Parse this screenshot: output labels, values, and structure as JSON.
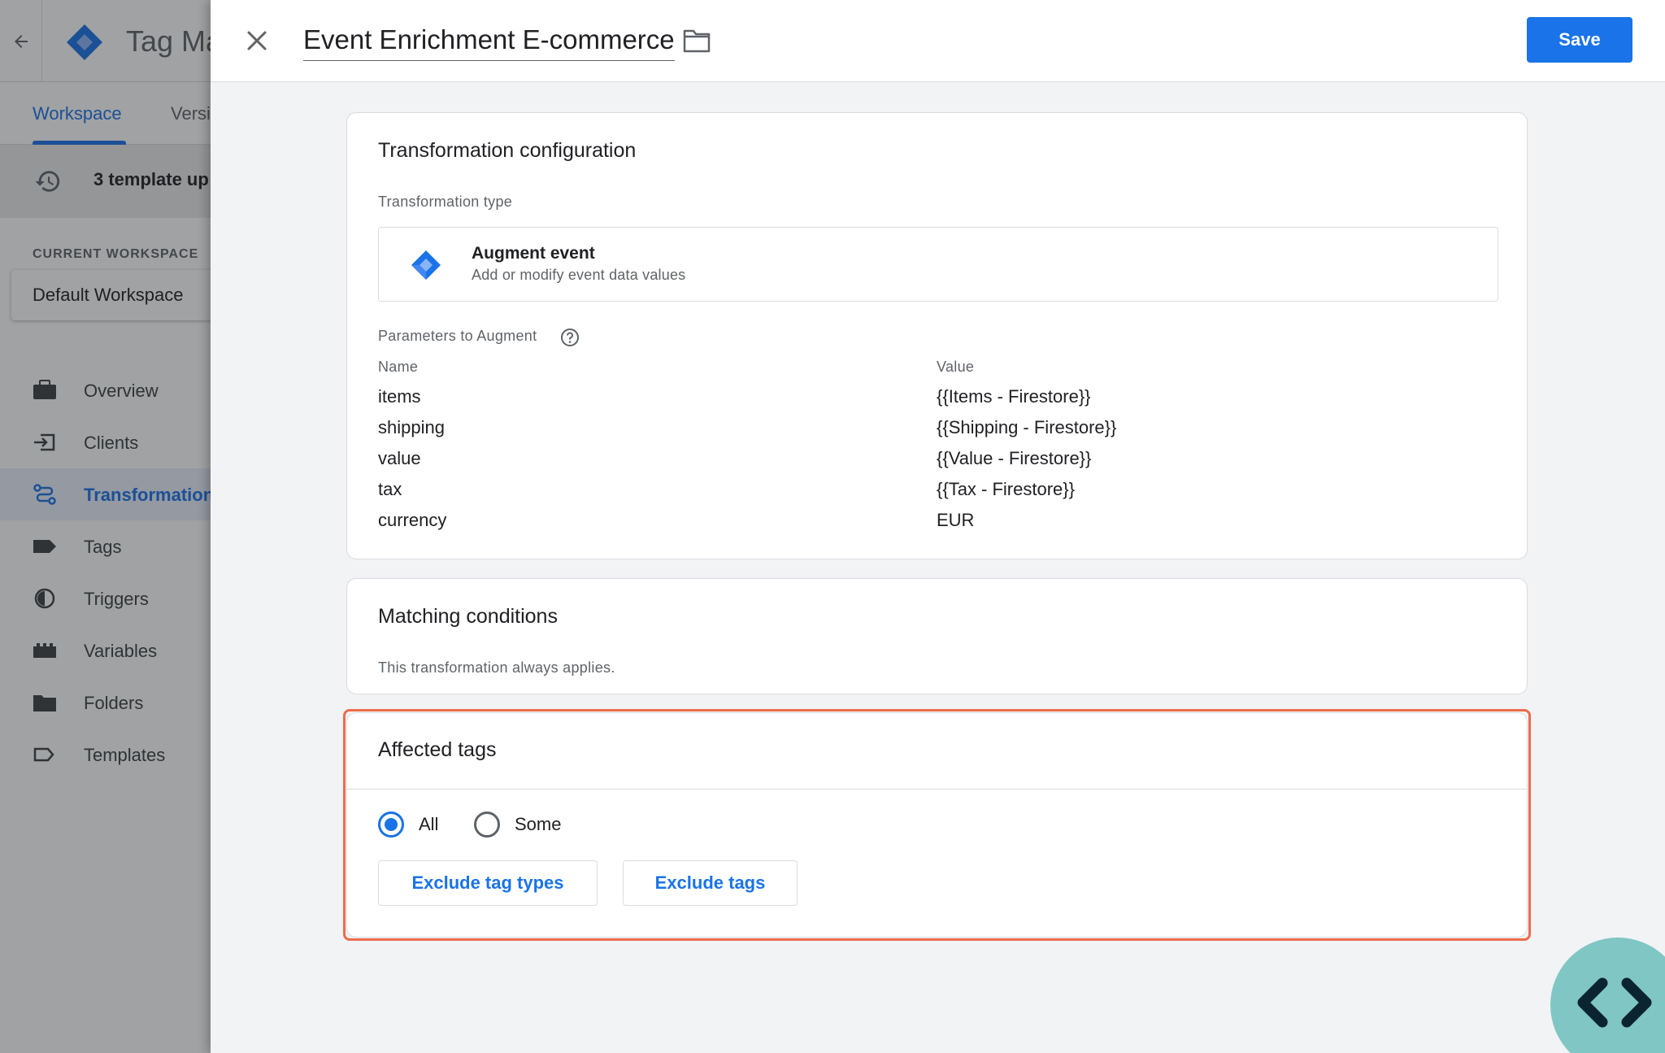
{
  "background": {
    "app_title": "Tag Ma",
    "tabs": [
      "Workspace",
      "Versi"
    ],
    "updates_text": "3 template up",
    "current_workspace_label": "CURRENT WORKSPACE",
    "current_workspace_name": "Default Workspace",
    "nav": [
      {
        "label": "Overview",
        "icon": "briefcase-icon"
      },
      {
        "label": "Clients",
        "icon": "login-icon"
      },
      {
        "label": "Transformation",
        "icon": "route-icon",
        "active": true
      },
      {
        "label": "Tags",
        "icon": "label-icon"
      },
      {
        "label": "Triggers",
        "icon": "trigger-icon"
      },
      {
        "label": "Variables",
        "icon": "variables-icon"
      },
      {
        "label": "Folders",
        "icon": "folder-icon"
      },
      {
        "label": "Templates",
        "icon": "template-label-icon"
      }
    ]
  },
  "panel": {
    "title": "Event Enrichment E-commerce",
    "save_label": "Save"
  },
  "config": {
    "title": "Transformation configuration",
    "type_label": "Transformation type",
    "type_name": "Augment event",
    "type_desc": "Add or modify event data values",
    "params_label": "Parameters to Augment",
    "col_name": "Name",
    "col_value": "Value",
    "params": [
      {
        "name": "items",
        "value": "{{Items - Firestore}}"
      },
      {
        "name": "shipping",
        "value": "{{Shipping - Firestore}}"
      },
      {
        "name": "value",
        "value": "{{Value - Firestore}}"
      },
      {
        "name": "tax",
        "value": "{{Tax - Firestore}}"
      },
      {
        "name": "currency",
        "value": "EUR"
      }
    ]
  },
  "matching": {
    "title": "Matching conditions",
    "text": "This transformation always applies."
  },
  "affected": {
    "title": "Affected tags",
    "option_all": "All",
    "option_some": "Some",
    "selected": "All",
    "exclude_types_label": "Exclude tag types",
    "exclude_tags_label": "Exclude tags"
  },
  "colors": {
    "accent": "#1a73e8",
    "highlight": "#ee6c4d",
    "fab": "#80c6c4"
  }
}
